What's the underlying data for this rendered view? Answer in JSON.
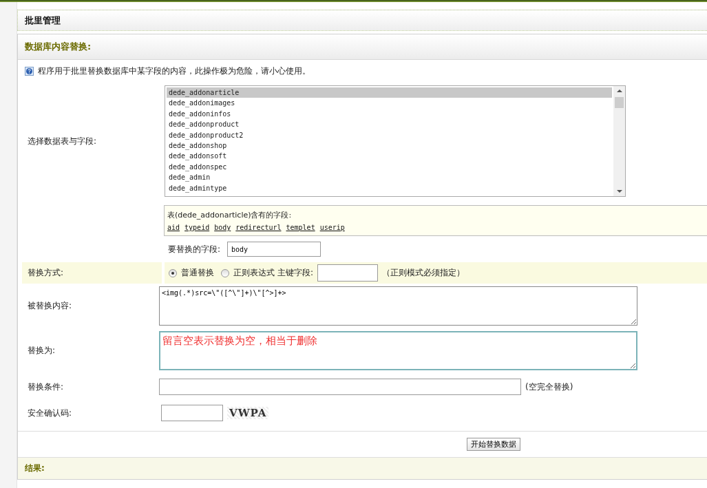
{
  "page_title": "批里管理",
  "panel_title": "数据库内容替换:",
  "notice": "程序用于批里替换数据库中某字段的内容，此操作极为危险，请小心使用。",
  "table_select": {
    "label": "选择数据表与字段:",
    "tables": [
      {
        "name": "dede_addonarticle",
        "selected": true
      },
      {
        "name": "dede_addonimages",
        "selected": false
      },
      {
        "name": "dede_addoninfos",
        "selected": false
      },
      {
        "name": "dede_addonproduct",
        "selected": false
      },
      {
        "name": "dede_addonproduct2",
        "selected": false
      },
      {
        "name": "dede_addonshop",
        "selected": false
      },
      {
        "name": "dede_addonsoft",
        "selected": false
      },
      {
        "name": "dede_addonspec",
        "selected": false
      },
      {
        "name": "dede_admin",
        "selected": false
      },
      {
        "name": "dede_admintype",
        "selected": false
      }
    ]
  },
  "fields_box": {
    "caption": "表(dede_addonarticle)含有的字段:",
    "fields": [
      "aid",
      "typeid",
      "body",
      "redirecturl",
      "templet",
      "userip"
    ]
  },
  "target_field": {
    "label": "要替换的字段:",
    "value": "body"
  },
  "mode": {
    "label": "替换方式:",
    "options": [
      {
        "label": "普通替换",
        "selected": true
      },
      {
        "label": "正则表达式",
        "selected": false
      }
    ],
    "key_label": "主键字段:",
    "note": "（正则模式必须指定）"
  },
  "find": {
    "label": "被替换内容:",
    "value": "<img(.*)src=\\\"([^\\\"]+)\\\"[^>]+>"
  },
  "replace": {
    "label": "替换为:",
    "placeholder": "留言空表示替换为空，相当于删除"
  },
  "condition": {
    "label": "替换条件:",
    "note": "(空完全替换)"
  },
  "captcha": {
    "label": "安全确认码:",
    "code": "VWPA"
  },
  "submit": "开始替换数据",
  "result_label": "结果:"
}
